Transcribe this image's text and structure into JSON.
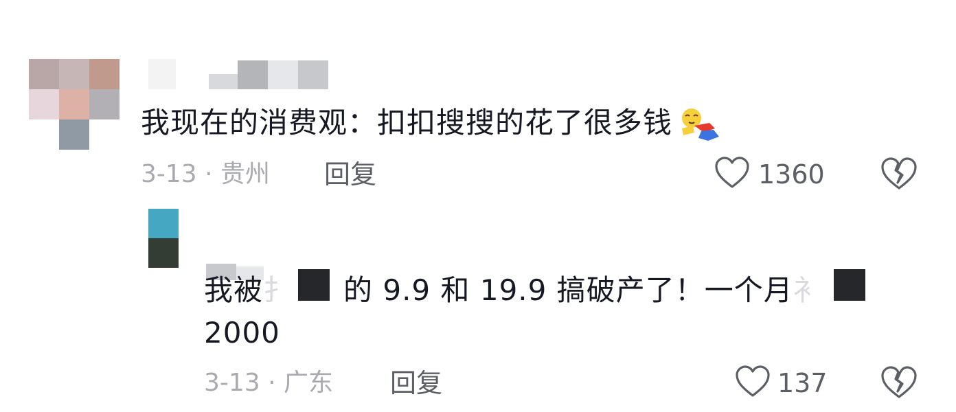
{
  "comments": [
    {
      "text": "我现在的消费观：扣扣搜搜的花了很多钱",
      "date_location": "3-13 · 贵州",
      "reply_label": "回复",
      "like_count": "1360"
    },
    {
      "text_part1": "我被",
      "text_part2": "的 9.9 和 19.9 搞破产了！一个月",
      "text_line2": "2000",
      "date_location": "3-13 · 广东",
      "reply_label": "回复",
      "like_count": "137"
    }
  ],
  "colors": {
    "text_primary": "#161823",
    "text_secondary": "#a9aab0",
    "action": "#5c5e66",
    "redaction": "#26272b"
  }
}
